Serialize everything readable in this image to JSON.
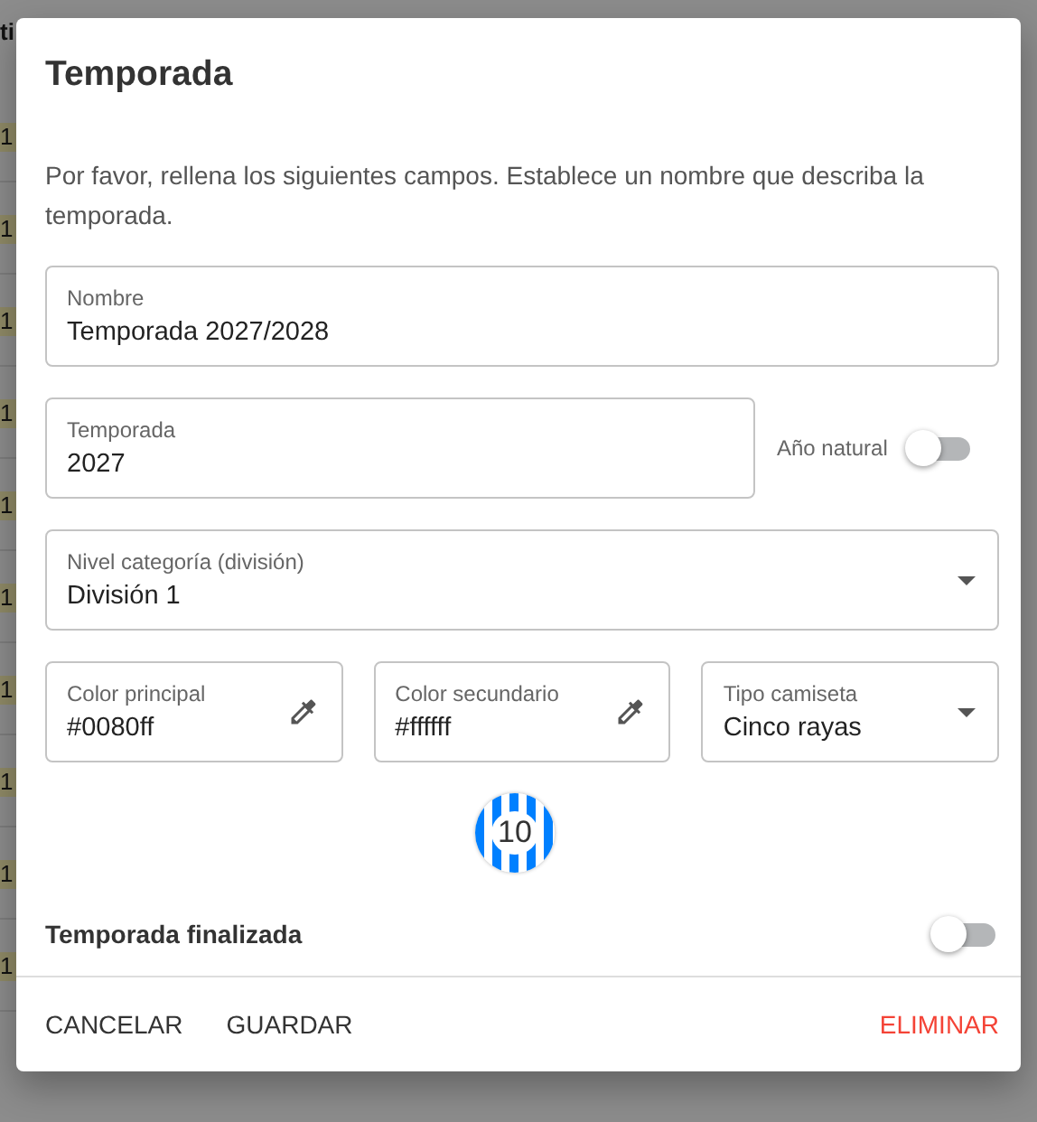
{
  "backdrop": {
    "column_1_header": "ti",
    "column_1": [
      "1",
      "1",
      "1",
      "1",
      "1",
      "1",
      "1",
      "1",
      "1",
      "1"
    ]
  },
  "dialog": {
    "title": "Temporada",
    "description": "Por favor, rellena los siguientes campos. Establece un nombre que describa la temporada.",
    "fields": [
      {
        "kind": "text",
        "label": "Nombre",
        "value": "Temporada 2027/2028"
      },
      {
        "kind": "text",
        "label": "Temporada",
        "value": "2027",
        "switch": {
          "label": "Año natural",
          "on": false
        }
      },
      {
        "kind": "select",
        "label": "Nivel categoría (división)",
        "value": "División 1"
      }
    ],
    "colors": [
      {
        "kind": "color",
        "label": "Color principal",
        "value": "#0080ff"
      },
      {
        "kind": "color",
        "label": "Color secundario",
        "value": "#ffffff"
      },
      {
        "kind": "select",
        "label": "Tipo camiseta",
        "value": "Cinco rayas"
      }
    ],
    "jersey": {
      "number": "10"
    },
    "finished": {
      "label": "Temporada finalizada",
      "on": false
    },
    "buttons": [
      {
        "label": "CANCELAR",
        "kind": "plain"
      },
      {
        "label": "GUARDAR",
        "kind": "plain"
      },
      {
        "label": "ELIMINAR",
        "kind": "danger"
      }
    ]
  }
}
